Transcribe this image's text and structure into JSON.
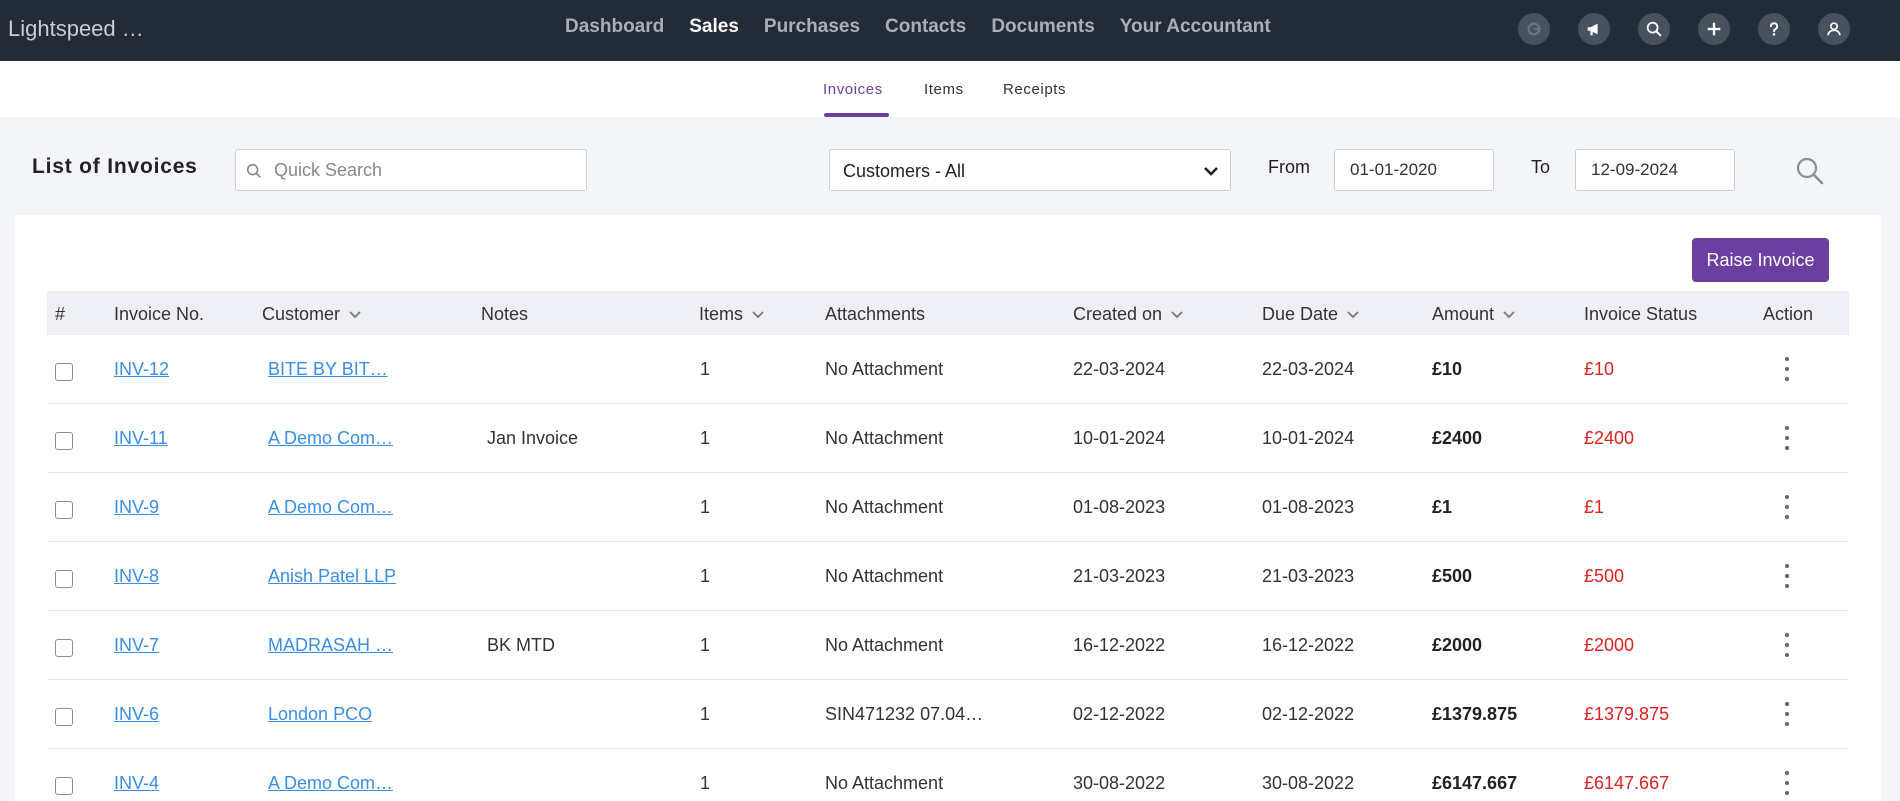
{
  "app": {
    "brand": "Lightspeed …"
  },
  "topnav": [
    "Dashboard",
    "Sales",
    "Purchases",
    "Contacts",
    "Documents",
    "Your Accountant"
  ],
  "topnav_active": "Sales",
  "top_icons": [
    "google-icon",
    "megaphone-icon",
    "search-icon",
    "plus-icon",
    "help-icon",
    "user-icon"
  ],
  "subtabs": [
    "Invoices",
    "Items",
    "Receipts"
  ],
  "subtab_active": "Invoices",
  "page": {
    "title": "List of Invoices"
  },
  "search": {
    "placeholder": "Quick Search",
    "value": ""
  },
  "customer_filter": {
    "selected": "Customers - All"
  },
  "date_from": {
    "label": "From",
    "value": "01-01-2020"
  },
  "date_to": {
    "label": "To",
    "value": "12-09-2024"
  },
  "raise_button": "Raise Invoice",
  "table": {
    "headers": [
      "#",
      "Invoice No.",
      "Customer",
      "Notes",
      "Items",
      "Attachments",
      "Created on",
      "Due Date",
      "Amount",
      "Invoice Status",
      "Action"
    ],
    "sortable": [
      "Customer",
      "Items",
      "Created on",
      "Due Date",
      "Amount"
    ],
    "rows": [
      {
        "invoice": "INV-12",
        "customer": "BITE BY BIT…",
        "notes": "",
        "items": "1",
        "attachments": "No Attachment",
        "created": "22-03-2024",
        "due": "22-03-2024",
        "amount": "£10",
        "status": "£10"
      },
      {
        "invoice": "INV-11",
        "customer": "A Demo Com…",
        "notes": "Jan Invoice",
        "items": "1",
        "attachments": "No Attachment",
        "created": "10-01-2024",
        "due": "10-01-2024",
        "amount": "£2400",
        "status": "£2400"
      },
      {
        "invoice": "INV-9",
        "customer": "A Demo Com…",
        "notes": "",
        "items": "1",
        "attachments": "No Attachment",
        "created": "01-08-2023",
        "due": "01-08-2023",
        "amount": "£1",
        "status": "£1"
      },
      {
        "invoice": "INV-8",
        "customer": "Anish Patel LLP",
        "notes": "",
        "items": "1",
        "attachments": "No Attachment",
        "created": "21-03-2023",
        "due": "21-03-2023",
        "amount": "£500",
        "status": "£500"
      },
      {
        "invoice": "INV-7",
        "customer": "MADRASAH …",
        "notes": "BK MTD",
        "items": "1",
        "attachments": "No Attachment",
        "created": "16-12-2022",
        "due": "16-12-2022",
        "amount": "£2000",
        "status": "£2000"
      },
      {
        "invoice": "INV-6",
        "customer": "London PCO",
        "notes": "",
        "items": "1",
        "attachments": "SIN471232 07.04…",
        "created": "02-12-2022",
        "due": "02-12-2022",
        "amount": "£1379.875",
        "status": "£1379.875"
      },
      {
        "invoice": "INV-4",
        "customer": "A Demo Com…",
        "notes": "",
        "items": "1",
        "attachments": "No Attachment",
        "created": "30-08-2022",
        "due": "30-08-2022",
        "amount": "£6147.667",
        "status": "£6147.667"
      }
    ]
  },
  "colors": {
    "navbar": "#222b36",
    "accent": "#6b3fa0",
    "link": "#3a8ee6",
    "status": "#e02020"
  }
}
